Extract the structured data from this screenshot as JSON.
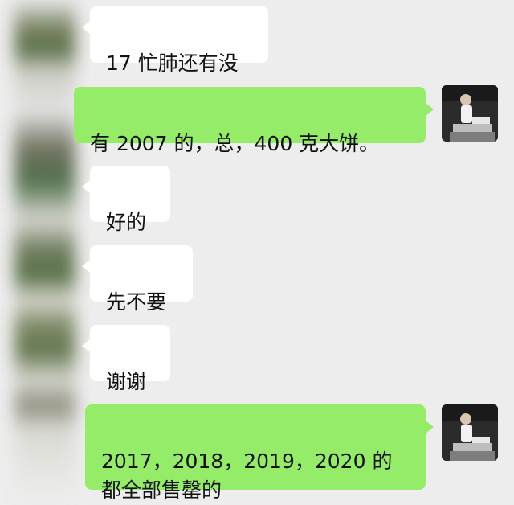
{
  "chat": {
    "messages": [
      {
        "side": "left",
        "text": "17 忙肺还有没"
      },
      {
        "side": "right",
        "text": "有 2007 的，总，400 克大饼。"
      },
      {
        "side": "left",
        "text": "好的"
      },
      {
        "side": "left",
        "text": "先不要"
      },
      {
        "side": "left",
        "text": "谢谢"
      },
      {
        "side": "right",
        "text": "2017，2018，2019，2020 的\n都全部售罄的"
      }
    ]
  },
  "colors": {
    "background": "#ededed",
    "incoming_bubble": "#ffffff",
    "outgoing_bubble": "#95ec69"
  },
  "icons": {
    "avatar": "user-avatar-photo"
  }
}
